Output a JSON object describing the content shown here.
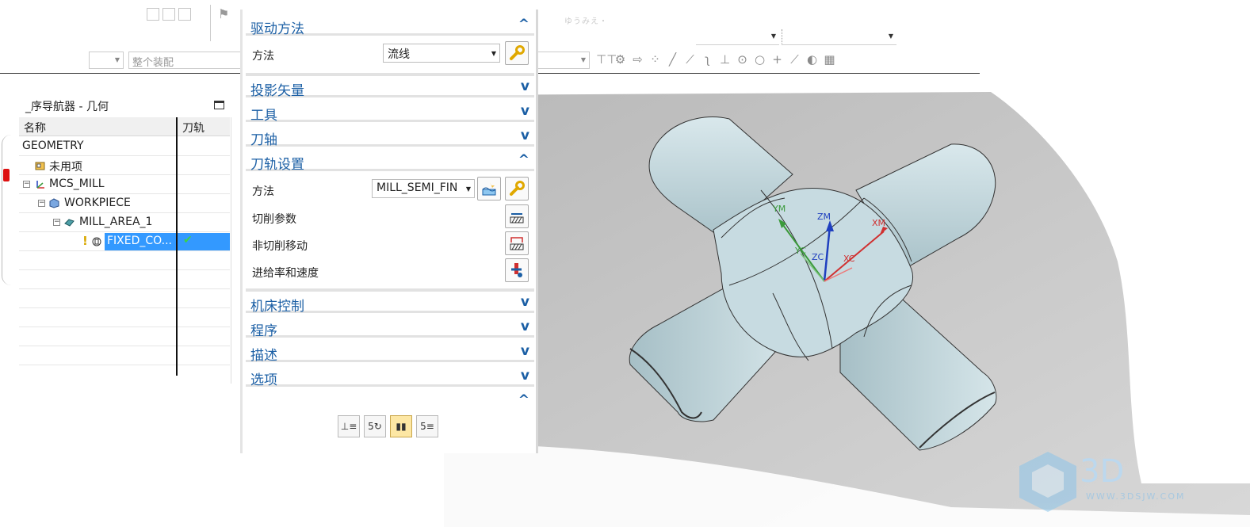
{
  "toolbar": {
    "assembly_combo": "整个装配",
    "faded_label": "ゆうみえ・"
  },
  "navigator": {
    "title": "_序导航器 - 几何",
    "col_name": "名称",
    "col_path": "刀轨",
    "rows": [
      {
        "label": "GEOMETRY"
      },
      {
        "label": "未用项"
      },
      {
        "label": "MCS_MILL"
      },
      {
        "label": "WORKPIECE"
      },
      {
        "label": "MILL_AREA_1"
      },
      {
        "label": "FIXED_CO...",
        "status": "✔"
      }
    ]
  },
  "dialog": {
    "sections": {
      "drive": "驱动方法",
      "projection": "投影矢量",
      "tool": "工具",
      "axis": "刀轴",
      "path_settings": "刀轨设置",
      "machine": "机床控制",
      "program": "程序",
      "description": "描述",
      "options": "选项"
    },
    "drive_method_label": "方法",
    "drive_method_value": "流线",
    "path_method_label": "方法",
    "path_method_value": "MILL_SEMI_FIN",
    "cut_params": "切削参数",
    "non_cut_moves": "非切削移动",
    "feeds_speeds": "进给率和速度"
  },
  "csys": {
    "ym": "YM",
    "zm": "ZM",
    "xm": "XM",
    "yc": "YC",
    "zc": "ZC",
    "xc": "XC"
  },
  "watermark": {
    "brand": "3D",
    "url": "WWW.3DSJW.COM"
  },
  "colors": {
    "accent_blue": "#1b5fa5",
    "selection": "#3399ff",
    "check_green": "#3bd14a",
    "part_surface": "#c5d9df",
    "viewport_bg": "#c9c9c9"
  }
}
